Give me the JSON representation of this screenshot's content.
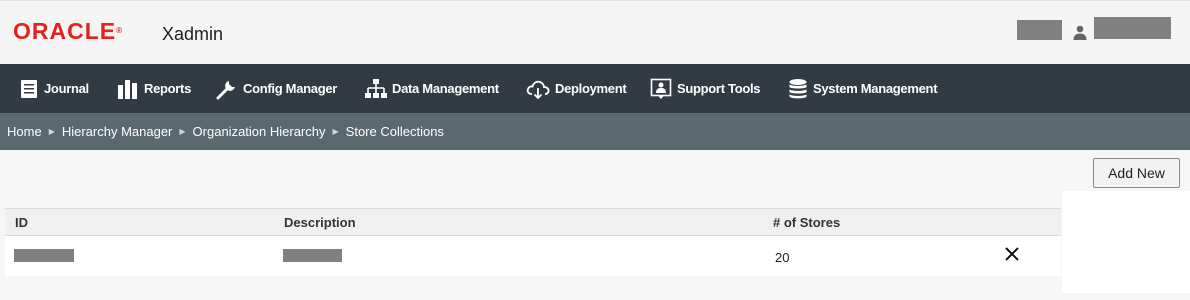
{
  "header": {
    "brand": "ORACLE",
    "app_name": "Xadmin"
  },
  "nav": {
    "items": [
      {
        "label": "Journal",
        "icon": "journal-icon"
      },
      {
        "label": "Reports",
        "icon": "bar-chart-icon"
      },
      {
        "label": "Config Manager",
        "icon": "wrench-icon"
      },
      {
        "label": "Data Management",
        "icon": "hierarchy-icon"
      },
      {
        "label": "Deployment",
        "icon": "cloud-download-icon"
      },
      {
        "label": "Support Tools",
        "icon": "support-icon"
      },
      {
        "label": "System Management",
        "icon": "database-icon"
      }
    ]
  },
  "breadcrumb": [
    "Home",
    "Hierarchy Manager",
    "Organization Hierarchy",
    "Store Collections"
  ],
  "actions": {
    "add_new": "Add New"
  },
  "table": {
    "columns": [
      "ID",
      "Description",
      "# of Stores"
    ],
    "rows": [
      {
        "stores": "20"
      }
    ]
  },
  "colors": {
    "brand_red": "#e3231b",
    "nav_bg": "#323b43",
    "breadcrumb_bg": "#5a6970"
  }
}
